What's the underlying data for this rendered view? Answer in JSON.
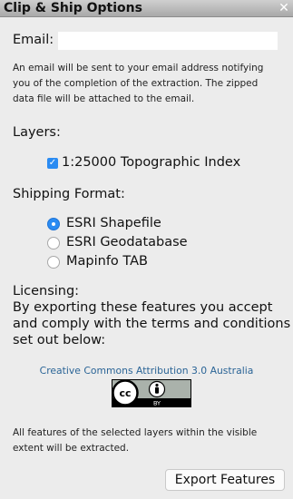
{
  "window": {
    "title": "Clip & Ship Options",
    "close_icon": "close-icon"
  },
  "email": {
    "label": "Email:",
    "value": "",
    "placeholder": "",
    "note_line1": "An email will be sent to your email address notifying",
    "note_line2": "you of the completion of the extraction. The zipped",
    "note_line3": "data file will be attached to the email."
  },
  "layers": {
    "heading": "Layers:",
    "items": [
      {
        "label": "1:25000 Topographic Index",
        "checked": true
      }
    ]
  },
  "shipping": {
    "heading": "Shipping Format:",
    "options": [
      {
        "label": "ESRI Shapefile",
        "selected": true
      },
      {
        "label": "ESRI Geodatabase",
        "selected": false
      },
      {
        "label": "Mapinfo TAB",
        "selected": false
      }
    ]
  },
  "licensing": {
    "heading": "Licensing:",
    "text_line1": "By exporting these features you accept",
    "text_line2": "and comply with the terms and conditions",
    "text_line3": "set out below:",
    "link_text": "Creative Commons Attribution 3.0 Australia",
    "badge_cc": "cc",
    "badge_by": "BY"
  },
  "footer": {
    "note_line1": "All features of the selected layers within the visible",
    "note_line2": "extent will be extracted.",
    "export_label": "Export Features"
  },
  "colors": {
    "accent": "#2a8bf2",
    "link": "#2a6496",
    "background": "#ececec"
  }
}
